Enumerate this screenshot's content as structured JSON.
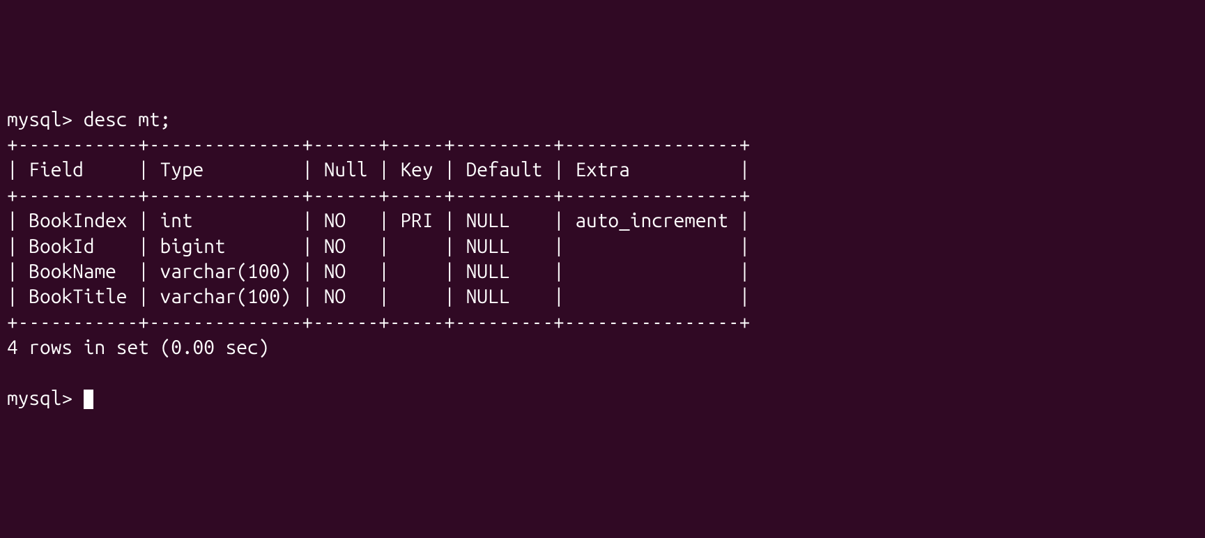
{
  "terminal": {
    "prompt1": "mysql> ",
    "command": "desc mt;",
    "border_top": "+-----------+--------------+------+-----+---------+----------------+",
    "header_row": "| Field     | Type         | Null | Key | Default | Extra          |",
    "border_mid": "+-----------+--------------+------+-----+---------+----------------+",
    "row1": "| BookIndex | int          | NO   | PRI | NULL    | auto_increment |",
    "row2": "| BookId    | bigint       | NO   |     | NULL    |                |",
    "row3": "| BookName  | varchar(100) | NO   |     | NULL    |                |",
    "row4": "| BookTitle | varchar(100) | NO   |     | NULL    |                |",
    "border_bot": "+-----------+--------------+------+-----+---------+----------------+",
    "result_msg": "4 rows in set (0.00 sec)",
    "blank": "",
    "prompt2": "mysql> "
  },
  "table_data": {
    "command": "desc mt;",
    "columns": [
      "Field",
      "Type",
      "Null",
      "Key",
      "Default",
      "Extra"
    ],
    "rows": [
      {
        "Field": "BookIndex",
        "Type": "int",
        "Null": "NO",
        "Key": "PRI",
        "Default": "NULL",
        "Extra": "auto_increment"
      },
      {
        "Field": "BookId",
        "Type": "bigint",
        "Null": "NO",
        "Key": "",
        "Default": "NULL",
        "Extra": ""
      },
      {
        "Field": "BookName",
        "Type": "varchar(100)",
        "Null": "NO",
        "Key": "",
        "Default": "NULL",
        "Extra": ""
      },
      {
        "Field": "BookTitle",
        "Type": "varchar(100)",
        "Null": "NO",
        "Key": "",
        "Default": "NULL",
        "Extra": ""
      }
    ],
    "rows_count": 4,
    "elapsed_sec": "0.00"
  }
}
